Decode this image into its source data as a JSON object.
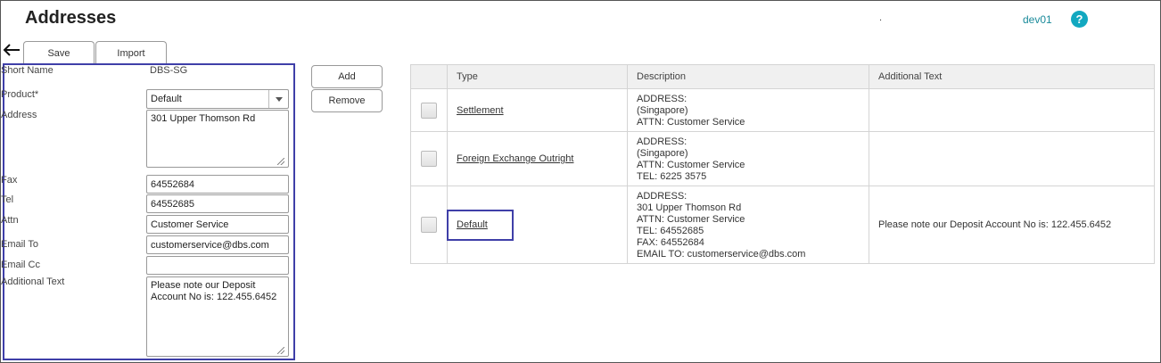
{
  "header": {
    "title": "Addresses",
    "dot": ".",
    "user": "dev01",
    "help": "?"
  },
  "toolbar": {
    "save_label": "Save",
    "import_label": "Import"
  },
  "form": {
    "short_name_label": "Short Name",
    "short_name_value": "DBS-SG",
    "product_label": "Product*",
    "product_value": "Default",
    "address_label": "Address",
    "address_value": "301 Upper Thomson Rd",
    "fax_label": "Fax",
    "fax_value": "64552684",
    "tel_label": "Tel",
    "tel_value": "64552685",
    "attn_label": "Attn",
    "attn_value": "Customer Service",
    "email_to_label": "Email To",
    "email_to_value": "customerservice@dbs.com",
    "email_cc_label": "Email Cc",
    "email_cc_value": "",
    "additional_text_label": "Additional Text",
    "additional_text_value": "Please note our Deposit Account No is: 122.455.6452"
  },
  "actions": {
    "add_label": "Add",
    "remove_label": "Remove"
  },
  "table": {
    "headers": {
      "type": "Type",
      "description": "Description",
      "additional_text": "Additional Text"
    },
    "rows": [
      {
        "type": "Settlement",
        "description": [
          "ADDRESS:",
          "(Singapore)",
          "ATTN: Customer Service"
        ],
        "additional_text": ""
      },
      {
        "type": "Foreign Exchange Outright",
        "description": [
          "ADDRESS:",
          "(Singapore)",
          "ATTN: Customer Service",
          "TEL: 6225 3575"
        ],
        "additional_text": ""
      },
      {
        "type": "Default",
        "description": [
          "ADDRESS:",
          "301 Upper Thomson Rd",
          "ATTN: Customer Service",
          "TEL: 64552685",
          "FAX: 64552684",
          "EMAIL TO: customerservice@dbs.com"
        ],
        "additional_text": "Please note our Deposit Account No is: 122.455.6452"
      }
    ]
  },
  "colors": {
    "highlight": "#3f3fa8",
    "accent": "#12a8c0",
    "user": "#1a8a9a"
  }
}
